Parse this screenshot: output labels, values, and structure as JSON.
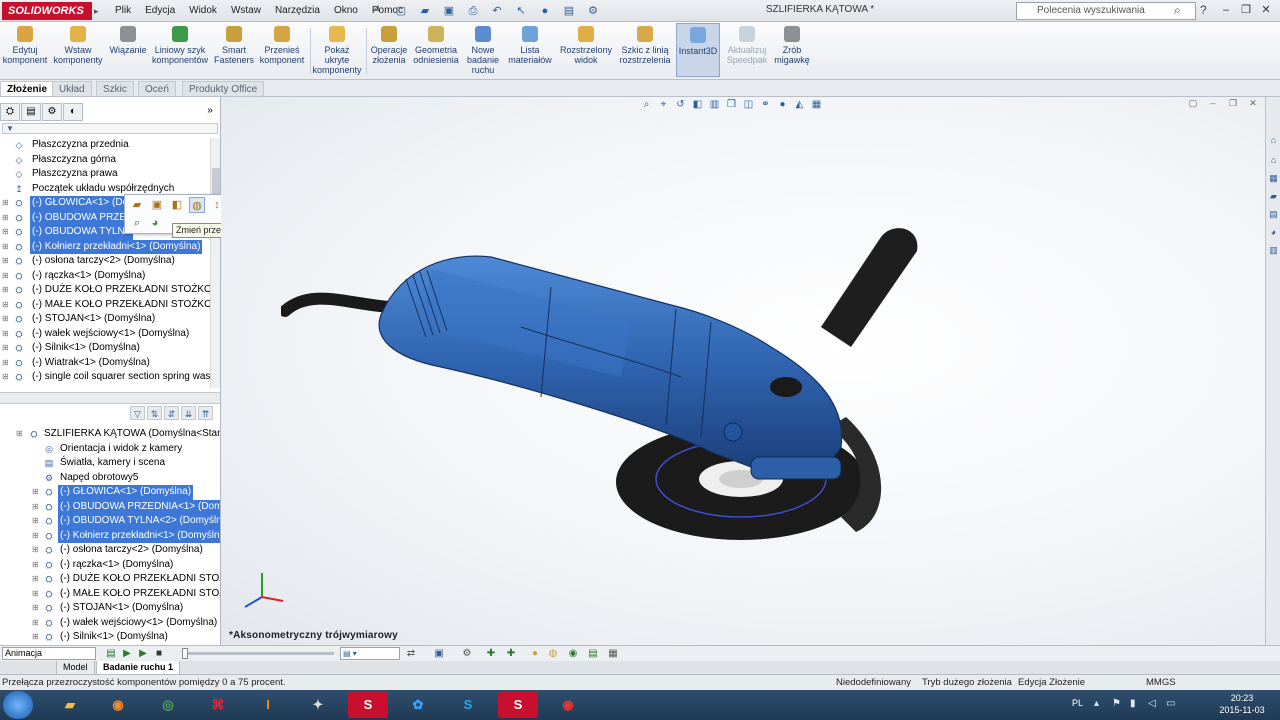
{
  "titlebar": {
    "app_name": "SOLIDWORKS",
    "menu": [
      "Plik",
      "Edycja",
      "Widok",
      "Wstaw",
      "Narzędzia",
      "Okno",
      "Pomoc"
    ],
    "document_title": "SZLIFIERKA KĄTOWA *",
    "search_placeholder": "Polecenia wyszukiwania"
  },
  "commands": [
    {
      "label": "Edytuj komponent",
      "icon": "edit-component-icon"
    },
    {
      "label": "Wstaw komponenty",
      "icon": "insert-components-icon"
    },
    {
      "label": "Wiązanie",
      "icon": "mate-icon"
    },
    {
      "label": "Liniowy szyk komponentów",
      "icon": "linear-pattern-icon"
    },
    {
      "label": "Smart Fasteners",
      "icon": "smart-fasteners-icon"
    },
    {
      "label": "Przenieś komponent",
      "icon": "move-component-icon"
    },
    {
      "label": "Pokaż ukryte komponenty",
      "icon": "show-hidden-icon"
    },
    {
      "label": "Operacje złożenia",
      "icon": "assembly-features-icon"
    },
    {
      "label": "Geometria odniesienia",
      "icon": "reference-geometry-icon"
    },
    {
      "label": "Nowe badanie ruchu",
      "icon": "new-motion-study-icon"
    },
    {
      "label": "Lista materiałów",
      "icon": "bom-icon"
    },
    {
      "label": "Rozstrzelony widok",
      "icon": "exploded-view-icon"
    },
    {
      "label": "Szkic z linią rozstrzelenia",
      "icon": "explode-line-sketch-icon"
    },
    {
      "label": "Instant3D",
      "icon": "instant3d-icon"
    },
    {
      "label": "Aktualizuj Speedpak",
      "icon": "speedpak-icon"
    },
    {
      "label": "Zrób migawkę",
      "icon": "snapshot-icon"
    }
  ],
  "command_tabs": [
    "Złożenie",
    "Układ",
    "Szkic",
    "Oceń",
    "Produkty Office"
  ],
  "tree_top": [
    {
      "label": "Płaszczyzna przednia",
      "icon": "plane-icon",
      "selected": false
    },
    {
      "label": "Płaszczyzna górna",
      "icon": "plane-icon",
      "selected": false
    },
    {
      "label": "Płaszczyzna prawa",
      "icon": "plane-icon",
      "selected": false
    },
    {
      "label": "Początek układu współrzędnych",
      "icon": "origin-icon",
      "selected": false
    },
    {
      "label": "(-) GŁOWICA<1> (Dom",
      "icon": "part-icon",
      "selected": true
    },
    {
      "label": "(-) OBUDOWA PRZEDN",
      "icon": "part-icon",
      "selected": true
    },
    {
      "label": "(-) OBUDOWA TYLNA",
      "icon": "part-icon",
      "selected": true
    },
    {
      "label": "(-) Kołnierz przekładni<1> (Domyślna)",
      "icon": "part-icon",
      "selected": true
    },
    {
      "label": "(-) osłona tarczy<2> (Domyślna)",
      "icon": "part-icon",
      "selected": false
    },
    {
      "label": "(-) rączka<1> (Domyślna)",
      "icon": "part-icon",
      "selected": false
    },
    {
      "label": "(-) DUŻE KOŁO PRZEKŁADNI STOŻKOWEJ",
      "icon": "part-icon",
      "selected": false
    },
    {
      "label": "(-) MAŁE KOŁO PRZEKŁADNI STOŻKOWE.",
      "icon": "part-icon",
      "selected": false
    },
    {
      "label": "(-) STOJAN<1> (Domyślna)",
      "icon": "part-icon",
      "selected": false
    },
    {
      "label": "(-) wałek wejściowy<1> (Domyślna)",
      "icon": "part-icon",
      "selected": false
    },
    {
      "label": "(-) Silnik<1> (Domyślna)",
      "icon": "part-icon",
      "selected": false
    },
    {
      "label": "(-) Wiatrak<1> (Domyślna)",
      "icon": "part-icon",
      "selected": false
    },
    {
      "label": "(-) single coil squarer section spring wash",
      "icon": "part-icon",
      "selected": false
    }
  ],
  "tree_bottom": [
    {
      "label": "SZLIFIERKA KĄTOWA  (Domyślna<Stan w",
      "icon": "assembly-icon",
      "selected": false,
      "root": true
    },
    {
      "label": "Orientacja i widok z kamery",
      "icon": "camera-icon",
      "selected": false
    },
    {
      "label": "Światła, kamery i scena",
      "icon": "lights-icon",
      "selected": false
    },
    {
      "label": "Napęd obrotowy5",
      "icon": "motor-icon",
      "selected": false
    },
    {
      "label": "(-) GŁOWICA<1> (Domyślna)",
      "icon": "part-icon",
      "selected": true
    },
    {
      "label": "(-) OBUDOWA PRZEDNIA<1> (Domy",
      "icon": "part-icon",
      "selected": true
    },
    {
      "label": "(-) OBUDOWA TYLNA<2> (Domyśln",
      "icon": "part-icon",
      "selected": true
    },
    {
      "label": "(-) Kołnierz przekładni<1> (Domyśln",
      "icon": "part-icon",
      "selected": true
    },
    {
      "label": "(-) osłona tarczy<2> (Domyślna)",
      "icon": "part-icon",
      "selected": false
    },
    {
      "label": "(-) rączka<1> (Domyślna)",
      "icon": "part-icon",
      "selected": false
    },
    {
      "label": "(-) DUŻE KOŁO PRZEKŁADNI STOŻKO",
      "icon": "part-icon",
      "selected": false
    },
    {
      "label": "(-) MAŁE KOŁO PRZEKŁADNI STOŻKO",
      "icon": "part-icon",
      "selected": false
    },
    {
      "label": "(-) STOJAN<1> (Domyślna)",
      "icon": "part-icon",
      "selected": false
    },
    {
      "label": "(-) wałek wejściowy<1> (Domyślna)",
      "icon": "part-icon",
      "selected": false
    },
    {
      "label": "(-) Silnik<1> (Domyślna)",
      "icon": "part-icon",
      "selected": false
    }
  ],
  "tooltip": "Zmień przezroczystość",
  "viewport": {
    "view_name": "*Aksonometryczny trójwymiarowy"
  },
  "motion": {
    "study_type": "Animacja",
    "tabs": [
      "Model",
      "Badanie ruchu 1"
    ]
  },
  "statusbar": {
    "message": "Przełącza przezroczystość komponentów pomiędzy 0 a 75 procent.",
    "state": "Niedodefiniowany",
    "mode": "Tryb dużego złożenia",
    "edit": "Edycja Złożenie",
    "units": "MMGS"
  },
  "taskbar": {
    "lang": "PL",
    "time": "20:23",
    "date": "2015-11-03"
  },
  "colors": {
    "selection": "#3d78d8",
    "part_blue": "#2f64b0",
    "brand_red": "#c8102e"
  }
}
